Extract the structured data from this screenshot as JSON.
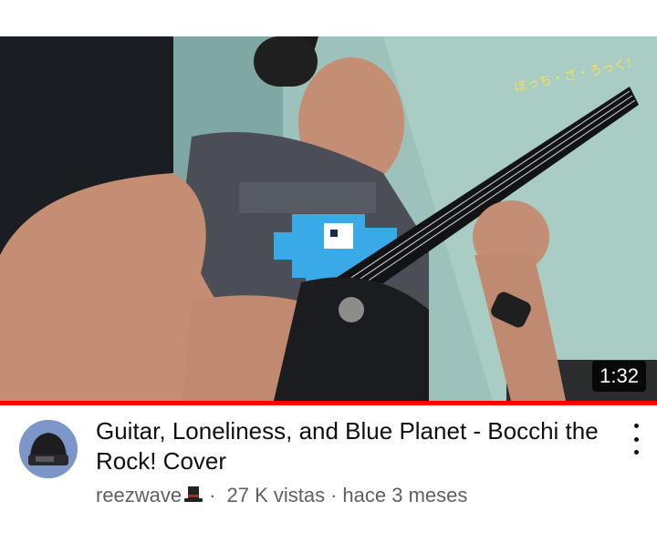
{
  "video": {
    "title": "Guitar, Loneliness, and Blue Planet - Bocchi the Rock! Cover",
    "duration": "1:32",
    "thumbnail_overlay_text": "ぼっち・ざ・ろっく!",
    "watch_progress": 1.0
  },
  "channel": {
    "name": "reezwave",
    "badge_icon": "top-hat-icon"
  },
  "stats": {
    "views": "27 K vistas",
    "age": "hace 3 meses",
    "separator": "·"
  },
  "colors": {
    "progress_bar": "#ff0000",
    "avatar_bg": "#7d96c9",
    "title_text": "#0f0f0f",
    "meta_text": "#606060"
  },
  "icons": {
    "menu": "more-vert-icon"
  }
}
